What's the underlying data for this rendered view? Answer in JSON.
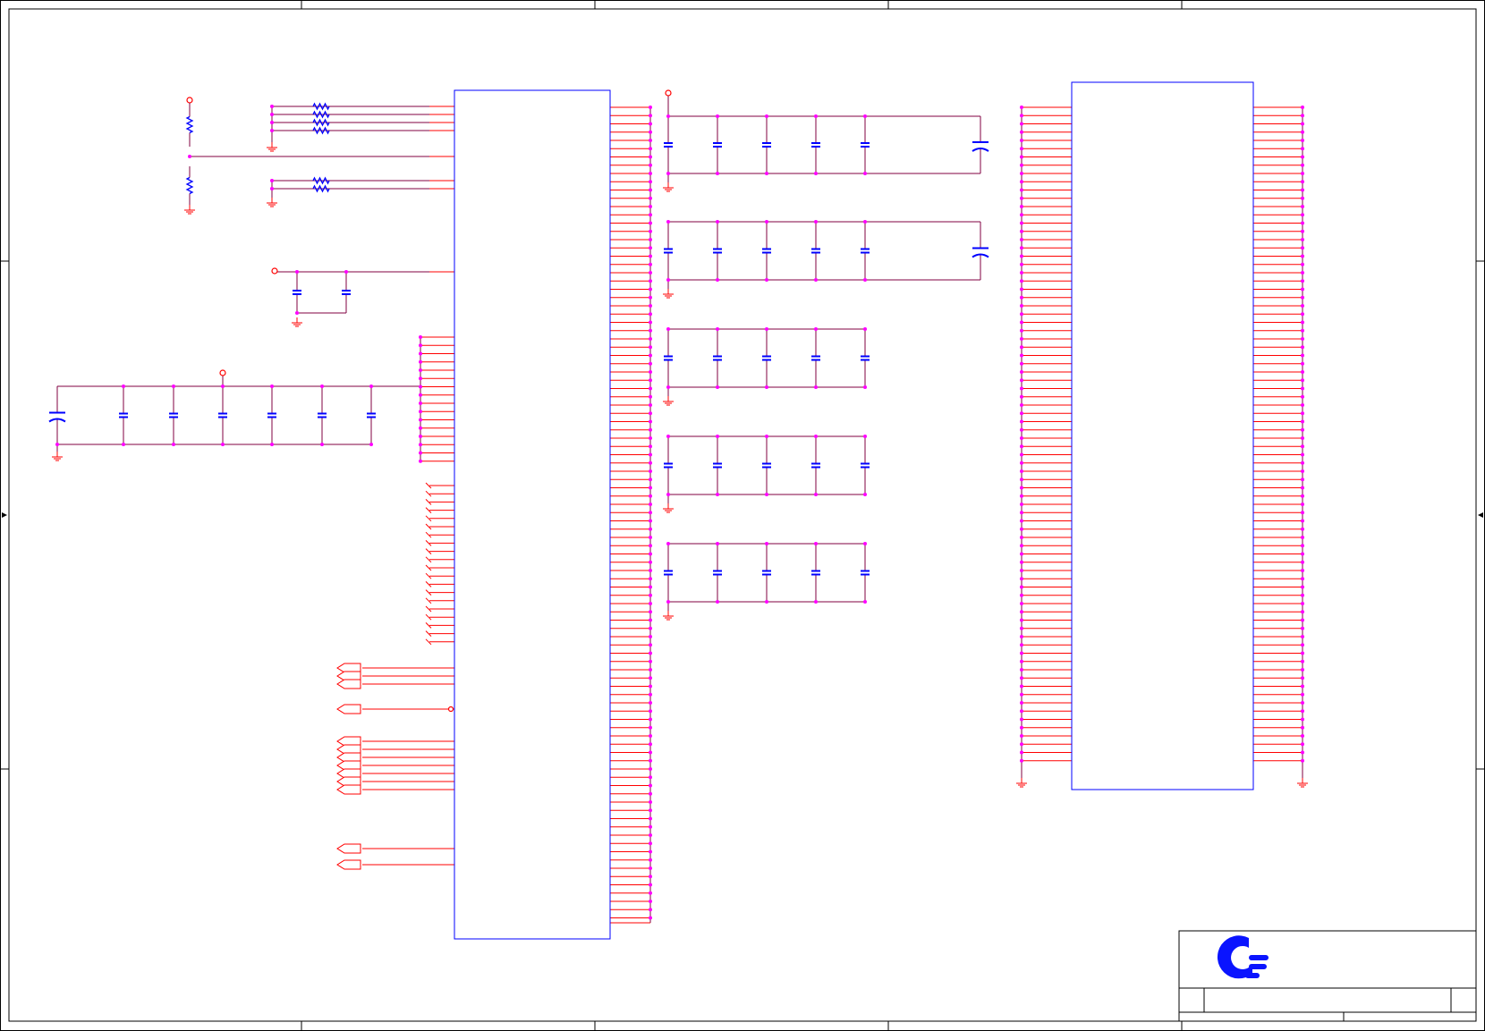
{
  "sheet": {
    "title_block": {
      "logo": "company-logo"
    }
  },
  "colors": {
    "wire": "#800040",
    "pin": "#ff0000",
    "component_body": "#0000ff",
    "junction": "#ff00ff",
    "logo": "#0a14ff"
  }
}
